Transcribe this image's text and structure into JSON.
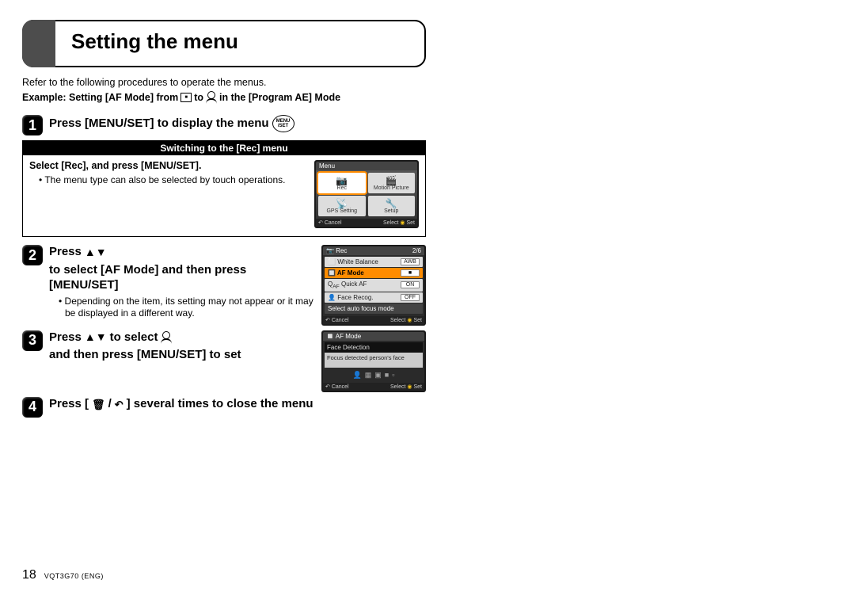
{
  "title": "Setting the menu",
  "intro": "Refer to the following procedures to operate the menus.",
  "example_prefix": "Example: Setting [AF Mode] from",
  "example_mid": "to",
  "example_suffix": "in the [Program AE] Mode",
  "step1_text": "Press [MENU/SET] to display the menu",
  "menu_set_top": "MENU",
  "menu_set_bot": "/SET",
  "rec_box": {
    "title": "Switching to the [Rec] menu",
    "select_line": "Select [Rec], and press [MENU/SET].",
    "bullet": "The menu type can also be selected by touch operations."
  },
  "screen1": {
    "header": "Menu",
    "tiles": [
      "Rec",
      "Motion Picture",
      "GPS Setting",
      "Setup"
    ],
    "cancel": "Cancel",
    "select": "Select",
    "set": "Set"
  },
  "step2_pre": "Press",
  "step2_post": "to select [AF Mode] and then press [MENU/SET]",
  "step2_bullet": "Depending on the item, its setting may not appear or it may be displayed in a different way.",
  "screen2": {
    "header_left": "Rec",
    "header_right": "2/6",
    "rows": [
      {
        "label": "White Balance",
        "val": "AWB"
      },
      {
        "label": "AF Mode",
        "val": "",
        "hl": true
      },
      {
        "label": "Quick AF",
        "val": "ON"
      },
      {
        "label": "Face Recog.",
        "val": "OFF"
      }
    ],
    "hint": "Select auto focus mode",
    "cancel": "Cancel",
    "select": "Select",
    "set": "Set"
  },
  "step3_pre": "Press",
  "step3_mid": "to select",
  "step3_post": "and then press [MENU/SET] to set",
  "screen3": {
    "header": "AF Mode",
    "select_label": "Face Detection",
    "desc": "Focus detected person's face",
    "cancel": "Cancel",
    "select": "Select",
    "set": "Set"
  },
  "step4_pre": "Press [",
  "step4_mid": "/",
  "step4_post": "] several times to close the menu",
  "footer": {
    "page": "18",
    "doc": "VQT3G70 (ENG)"
  }
}
